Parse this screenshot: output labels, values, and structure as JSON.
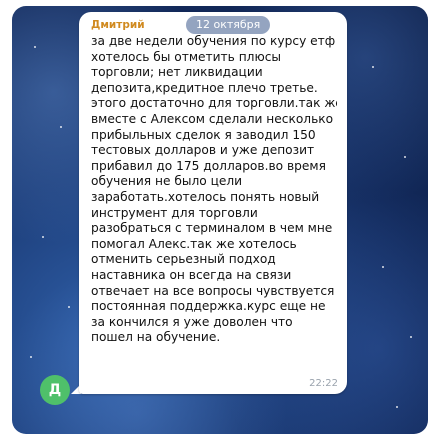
{
  "message": {
    "sender": "Дмитрий",
    "date": "12 октября",
    "time": "22:22",
    "avatar_letter": "Д",
    "lines": [
      "за две недели обучения по курсу етф",
      "хотелось бы отметить плюсы",
      "торговли; нет ликвидации",
      "депозита,кредитное плечо третье.",
      "этого достаточно для торговли.так же",
      "вместе с Алексом сделали несколько",
      "прибыльных сделок я заводил 150",
      "тестовых долларов и уже депозит",
      "прибавил до 175 долларов.во время",
      "обучения не было цели",
      "заработать.хотелось понять новый",
      "инструмент для торговли",
      "разобраться с терминалом в чем мне",
      "помогал Алекс.так же хотелось",
      "отменить серьезный подход",
      "наставника он всегда на связи",
      "отвечает на все вопросы чувствуется",
      "постоянная поддержка.курс еще не",
      "за кончился я уже доволен что",
      "пошел на обучение."
    ]
  },
  "colors": {
    "sender_name": "#d08a20",
    "avatar_bg": "#4fc06a",
    "bubble_bg": "#ffffff",
    "time_text": "#9aa3ad"
  }
}
